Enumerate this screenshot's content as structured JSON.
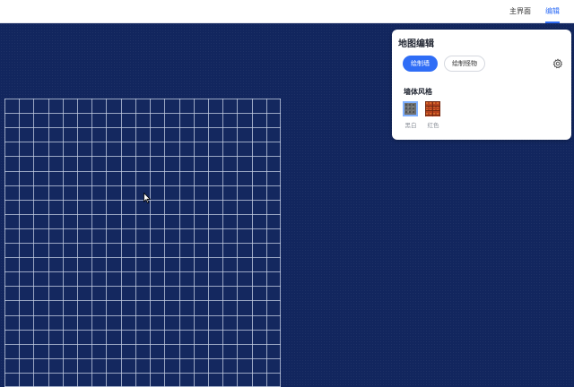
{
  "nav": {
    "items": [
      {
        "label": "主界面",
        "active": false
      },
      {
        "label": "编辑",
        "active": true
      }
    ]
  },
  "map": {
    "grid": {
      "columns": 19,
      "rows": 20
    }
  },
  "panel": {
    "title": "地图编辑",
    "tabs": [
      {
        "label": "绘制墙",
        "active": true
      },
      {
        "label": "绘制怪物",
        "active": false
      }
    ],
    "settings_icon": "gear-icon",
    "wall_style": {
      "title": "墙体风格",
      "options": [
        {
          "label": "黑白",
          "selected": true
        },
        {
          "label": "红色",
          "selected": false
        }
      ]
    }
  },
  "colors": {
    "accent": "#2f6df6",
    "background": "#12265e",
    "grid_line": "#c9d2e6"
  },
  "cursor_icon": "arrow-cursor-icon"
}
